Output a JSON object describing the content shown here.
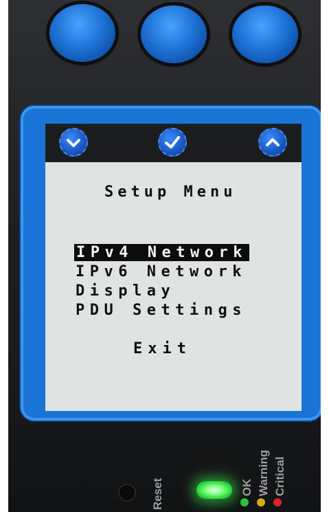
{
  "hardware_buttons": [
    {
      "icon": "button-left"
    },
    {
      "icon": "button-middle"
    },
    {
      "icon": "button-right"
    }
  ],
  "nav_icons": {
    "left": "chevron-down",
    "middle": "checkmark",
    "right": "chevron-up"
  },
  "screen": {
    "title": "Setup Menu",
    "items": [
      {
        "label": "IPv4 Network",
        "selected": true
      },
      {
        "label": "IPv6 Network",
        "selected": false
      },
      {
        "label": "Display",
        "selected": false
      },
      {
        "label": "PDU Settings",
        "selected": false
      }
    ],
    "exit_label": "Exit"
  },
  "panel": {
    "reset_label": "Reset",
    "status_labels": [
      "OK",
      "Warning",
      "Critical"
    ],
    "status_colors": {
      "ok": "#2fbf3a",
      "warning": "#d9a81f",
      "critical": "#d8242b"
    }
  },
  "colors": {
    "accent_blue": "#1a74d6",
    "screen_bg": "#dfe3e2",
    "led_green": "#22d43a"
  }
}
